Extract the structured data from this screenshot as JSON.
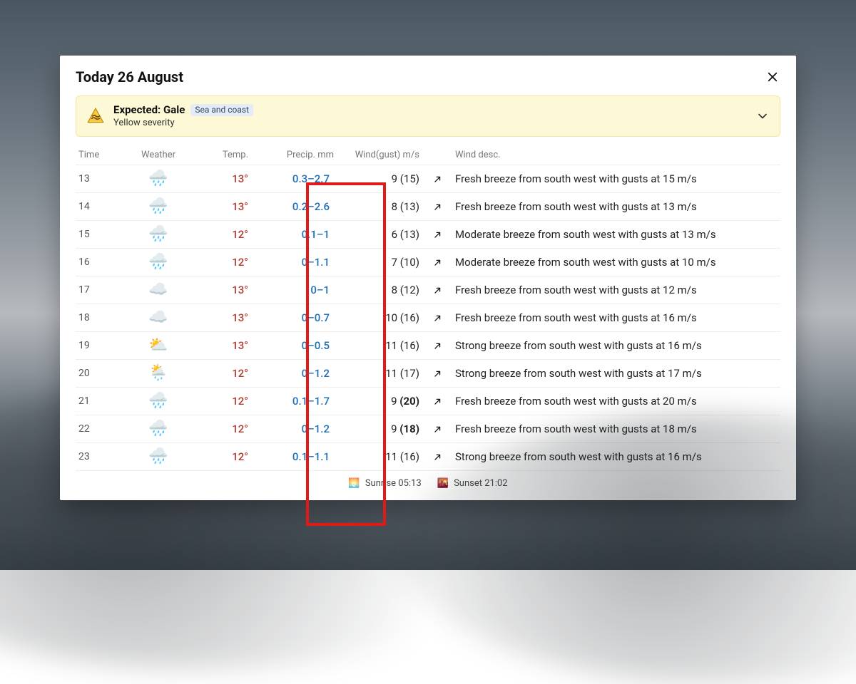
{
  "title": "Today 26 August",
  "alert": {
    "title": "Expected: Gale",
    "badge": "Sea and coast",
    "sub": "Yellow severity"
  },
  "columns": {
    "time": "Time",
    "weather": "Weather",
    "temp": "Temp.",
    "precip": "Precip. mm",
    "wind": "Wind(gust) m/s",
    "winddesc": "Wind desc."
  },
  "rows": [
    {
      "time": "13",
      "icon": "🌧️",
      "temp": "13°",
      "precip": "0.3–2.7",
      "wind": "9 (15)",
      "gust_bold": false,
      "arrow_deg": 45,
      "desc": "Fresh breeze from south west with gusts at 15 m/s"
    },
    {
      "time": "14",
      "icon": "🌧️",
      "temp": "13°",
      "precip": "0.2–2.6",
      "wind": "8 (13)",
      "gust_bold": false,
      "arrow_deg": 45,
      "desc": "Fresh breeze from south west with gusts at 13 m/s"
    },
    {
      "time": "15",
      "icon": "🌧️",
      "temp": "12°",
      "precip": "0.1–1",
      "wind": "6 (13)",
      "gust_bold": false,
      "arrow_deg": 45,
      "desc": "Moderate breeze from south west with gusts at 13 m/s"
    },
    {
      "time": "16",
      "icon": "🌧️",
      "temp": "12°",
      "precip": "0–1.1",
      "wind": "7 (10)",
      "gust_bold": false,
      "arrow_deg": 45,
      "desc": "Moderate breeze from south west with gusts at 10 m/s"
    },
    {
      "time": "17",
      "icon": "☁️",
      "temp": "13°",
      "precip": "0–1",
      "wind": "8 (12)",
      "gust_bold": false,
      "arrow_deg": 45,
      "desc": "Fresh breeze from south west with gusts at 12 m/s"
    },
    {
      "time": "18",
      "icon": "☁️",
      "temp": "13°",
      "precip": "0–0.7",
      "wind": "10 (16)",
      "gust_bold": false,
      "arrow_deg": 45,
      "desc": "Fresh breeze from south west with gusts at 16 m/s"
    },
    {
      "time": "19",
      "icon": "⛅",
      "temp": "13°",
      "precip": "0–0.5",
      "wind": "11 (16)",
      "gust_bold": false,
      "arrow_deg": 45,
      "desc": "Strong breeze from south west with gusts at 16 m/s"
    },
    {
      "time": "20",
      "icon": "🌦️",
      "temp": "12°",
      "precip": "0–1.2",
      "wind": "11 (17)",
      "gust_bold": false,
      "arrow_deg": 45,
      "desc": "Strong breeze from south west with gusts at 17 m/s"
    },
    {
      "time": "21",
      "icon": "🌧️",
      "temp": "12°",
      "precip": "0.1–1.7",
      "wind": "9 (20)",
      "gust_bold": true,
      "arrow_deg": 45,
      "desc": "Fresh breeze from south west with gusts at 20 m/s"
    },
    {
      "time": "22",
      "icon": "🌧️",
      "temp": "12°",
      "precip": "0–1.2",
      "wind": "9 (18)",
      "gust_bold": true,
      "arrow_deg": 45,
      "desc": "Fresh breeze from south west with gusts at 18 m/s"
    },
    {
      "time": "23",
      "icon": "🌧️",
      "temp": "12°",
      "precip": "0.1–1.1",
      "wind": "11 (16)",
      "gust_bold": false,
      "arrow_deg": 45,
      "desc": "Strong breeze from south west with gusts at 16 m/s"
    }
  ],
  "footer": {
    "sunrise_label": "Sunrise",
    "sunrise_time": "05:13",
    "sunset_label": "Sunset",
    "sunset_time": "21:02"
  }
}
